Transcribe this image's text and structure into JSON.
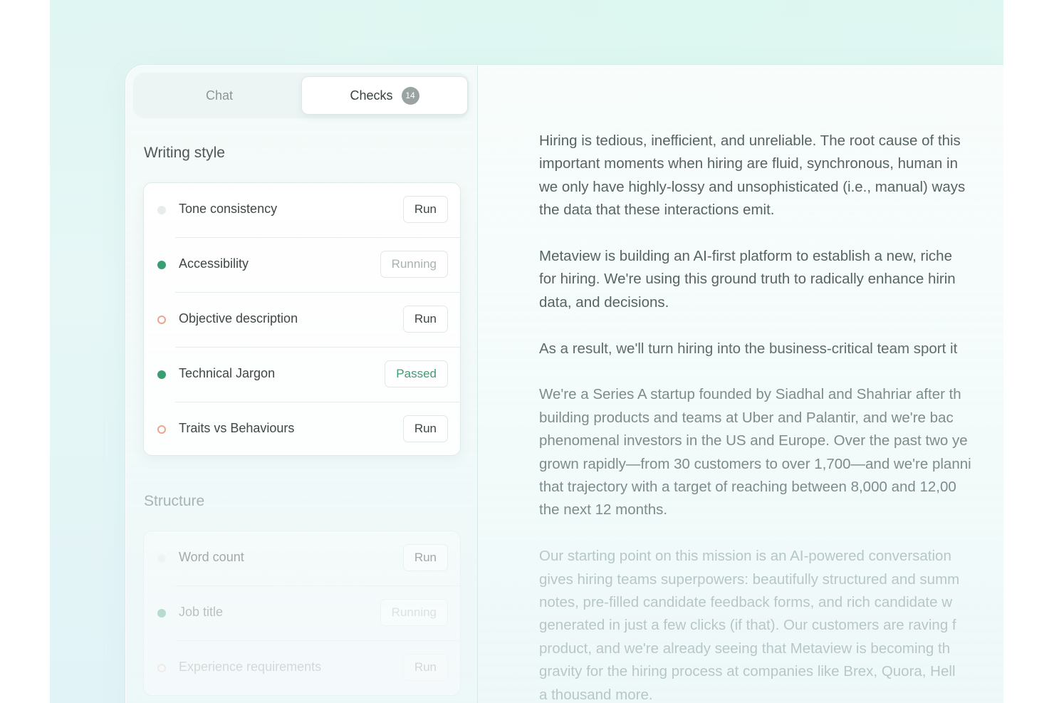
{
  "tabs": {
    "chat": "Chat",
    "checks": "Checks",
    "checks_count": "14"
  },
  "sections": {
    "writing_style": {
      "title": "Writing style",
      "checks": [
        {
          "label": "Tone consistency",
          "action": "Run",
          "status": "idle"
        },
        {
          "label": "Accessibility",
          "action": "Running",
          "status": "running"
        },
        {
          "label": "Objective description",
          "action": "Run",
          "status": "warning"
        },
        {
          "label": "Technical Jargon",
          "action": "Passed",
          "status": "passed"
        },
        {
          "label": "Traits vs Behaviours",
          "action": "Run",
          "status": "warning"
        }
      ]
    },
    "structure": {
      "title": "Structure",
      "checks": [
        {
          "label": "Word count",
          "action": "Run",
          "status": "idle"
        },
        {
          "label": "Job title",
          "action": "Running",
          "status": "running"
        },
        {
          "label": "Experience requirements",
          "action": "Run",
          "status": "warning"
        }
      ]
    }
  },
  "document": {
    "paragraphs": [
      "Hiring is tedious, inefficient, and unreliable. The root cause of this\nimportant moments when hiring are fluid, synchronous, human in\nwe only have highly-lossy and unsophisticated (i.e., manual) ways\nthe data that these interactions emit.",
      "Metaview is building an AI-first platform to establish a new, riche\nfor hiring. We're using this ground truth to radically enhance hirin\ndata, and decisions.",
      "As a result, we'll turn hiring into the business-critical team sport it",
      "We're a Series A startup founded by Siadhal and Shahriar after th\nbuilding products and teams at Uber and Palantir, and we're bac\nphenomenal investors in the US and Europe. Over the past two ye\ngrown rapidly—from 30 customers to over 1,700—and we're planni\nthat trajectory with a target of reaching between 8,000 and 12,00\nthe next 12 months.",
      "Our starting point on this mission is an AI-powered conversation\ngives hiring teams superpowers: beautifully structured and summ\nnotes, pre-filled candidate feedback forms, and rich candidate w\ngenerated in just a few clicks (if that). Our customers are raving f\nproduct, and we're already seeing that Metaview is becoming th\ngravity for the hiring process at companies like Brex, Quora, Hell\na thousand more."
    ]
  },
  "colors": {
    "passed": "#3a9e73",
    "warning_ring": "#eba78e",
    "idle_dot": "#e7ecec"
  }
}
